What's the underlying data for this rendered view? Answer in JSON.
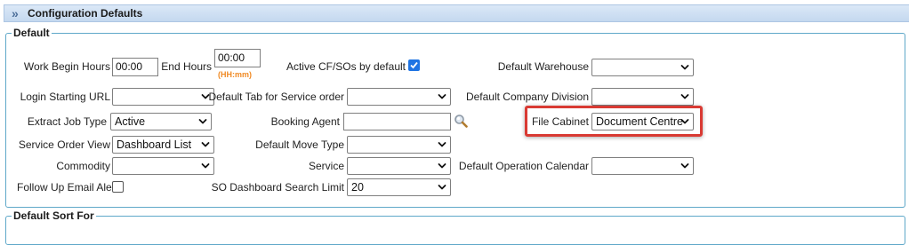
{
  "section": {
    "title": "Configuration Defaults"
  },
  "default_group": {
    "legend": "Default"
  },
  "fields": {
    "work_begin_hours": {
      "label": "Work Begin Hours",
      "value": "00:00"
    },
    "end_hours": {
      "label": "End Hours",
      "value": "00:00",
      "hint": "(HH:mm)"
    },
    "active_cf": {
      "label": "Active CF/SOs by default",
      "checked": true
    },
    "default_warehouse": {
      "label": "Default Warehouse",
      "value": ""
    },
    "login_starting_url": {
      "label": "Login Starting URL",
      "value": ""
    },
    "default_tab": {
      "label": "Default Tab for Service order",
      "value": ""
    },
    "default_company_division": {
      "label": "Default Company Division",
      "value": ""
    },
    "extract_job_type": {
      "label": "Extract Job Type",
      "value": "Active"
    },
    "booking_agent": {
      "label": "Booking Agent",
      "value": ""
    },
    "file_cabinet": {
      "label": "File Cabinet",
      "value": "Document Centre"
    },
    "service_order_view": {
      "label": "Service Order View",
      "value": "Dashboard List"
    },
    "default_move_type": {
      "label": "Default Move Type",
      "value": ""
    },
    "commodity": {
      "label": "Commodity",
      "value": ""
    },
    "service": {
      "label": "Service",
      "value": ""
    },
    "default_operation_calendar": {
      "label": "Default Operation Calendar",
      "value": ""
    },
    "follow_up_email_alert": {
      "label": "Follow Up Email Alert",
      "checked": false
    },
    "so_dashboard_search_limit": {
      "label": "SO Dashboard Search Limit",
      "value": "20"
    }
  },
  "sort_group": {
    "legend": "Default Sort For"
  },
  "colors": {
    "accent": "#1f74e3",
    "highlight": "#d93a33",
    "hint": "#f08a24",
    "border": "#5fa8c9"
  },
  "icons": [
    "chevron-double-right-icon",
    "magnifier-icon",
    "checkmark-icon",
    "chevron-down-icon"
  ]
}
